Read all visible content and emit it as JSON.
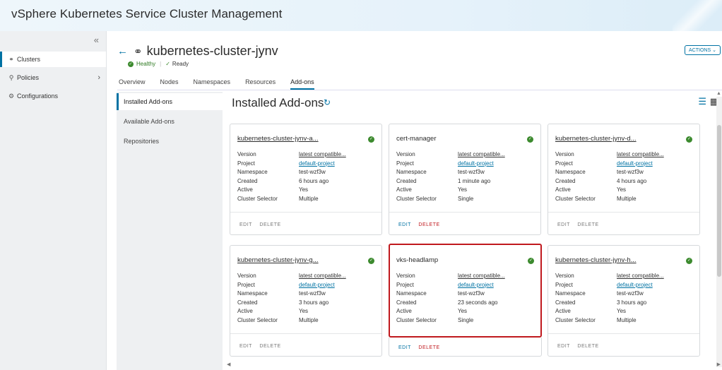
{
  "app": {
    "title": "vSphere Kubernetes Service Cluster Management"
  },
  "sidebar": {
    "collapse_icon": "double-chevron-left-icon",
    "items": [
      {
        "label": "Clusters",
        "icon": "clusters-icon",
        "active": true
      },
      {
        "label": "Policies",
        "icon": "policies-icon",
        "has_submenu": true
      },
      {
        "label": "Configurations",
        "icon": "configurations-icon"
      }
    ]
  },
  "header": {
    "cluster_name": "kubernetes-cluster-jynv",
    "health": "Healthy",
    "ready": "Ready",
    "actions_label": "ACTIONS"
  },
  "tabs": [
    "Overview",
    "Nodes",
    "Namespaces",
    "Resources",
    "Add-ons"
  ],
  "active_tab": "Add-ons",
  "subnav": [
    "Installed Add-ons",
    "Available Add-ons",
    "Repositories"
  ],
  "content": {
    "title": "Installed Add-ons"
  },
  "prop_labels": {
    "version": "Version",
    "project": "Project",
    "namespace": "Namespace",
    "created": "Created",
    "active": "Active",
    "selector": "Cluster Selector"
  },
  "button_labels": {
    "edit": "EDIT",
    "delete": "DELETE"
  },
  "cards": [
    {
      "name": "kubernetes-cluster-jynv-a...",
      "version": "latest compatible...",
      "project": "default-project",
      "namespace": "test-wzf3w",
      "created": "6 hours ago",
      "active": "Yes",
      "selector": "Multiple"
    },
    {
      "name": "cert-manager",
      "version": "latest compatible...",
      "project": "default-project",
      "namespace": "test-wzf3w",
      "created": "1 minute ago",
      "active": "Yes",
      "selector": "Single"
    },
    {
      "name": "kubernetes-cluster-jynv-d...",
      "version": "latest compatible...",
      "project": "default-project",
      "namespace": "test-wzf3w",
      "created": "4 hours ago",
      "active": "Yes",
      "selector": "Multiple"
    },
    {
      "name": "kubernetes-cluster-jynv-g...",
      "version": "latest compatible...",
      "project": "default-project",
      "namespace": "test-wzf3w",
      "created": "3 hours ago",
      "active": "Yes",
      "selector": "Multiple"
    },
    {
      "name": "vks-headlamp",
      "version": "latest compatible...",
      "project": "default-project",
      "namespace": "test-wzf3w",
      "created": "23 seconds ago",
      "active": "Yes",
      "selector": "Single"
    },
    {
      "name": "kubernetes-cluster-jynv-h...",
      "version": "latest compatible...",
      "project": "default-project",
      "namespace": "test-wzf3w",
      "created": "3 hours ago",
      "active": "Yes",
      "selector": "Multiple"
    }
  ],
  "colors": {
    "accent": "#0072a3",
    "success": "#3c8a2e",
    "danger": "#c0191e"
  }
}
